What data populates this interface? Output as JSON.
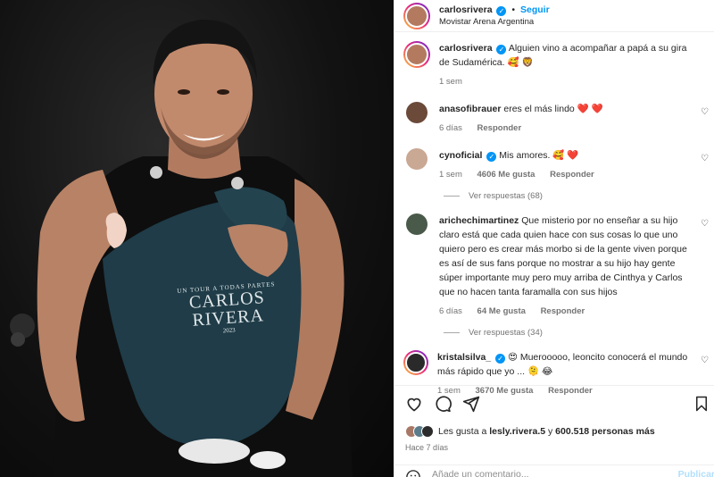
{
  "photo": {
    "sweatshirt_text_small": "UN TOUR A TODAS PARTES",
    "sweatshirt_text_big": "CARLOS RIVERA",
    "sweatshirt_year": "2023"
  },
  "header": {
    "username": "carlosrivera",
    "follow_label": "Seguir",
    "location": "Movistar Arena Argentina"
  },
  "caption": {
    "username": "carlosrivera",
    "text": "Alguien vino a acompañar a papá a su gira de Sudamérica. 🥰 🦁",
    "time": "1 sem"
  },
  "comments": [
    {
      "username": "anasofibrauer",
      "verified": false,
      "text": "eres el más lindo ❤️ ❤️",
      "time": "6 días",
      "likes": "",
      "reply": "Responder",
      "avatar_color": "#6b4a3a"
    },
    {
      "username": "cynoficial",
      "verified": true,
      "text": "Mis amores. 🥰 ❤️",
      "time": "1 sem",
      "likes": "4606 Me gusta",
      "reply": "Responder",
      "view_replies": "Ver respuestas (68)",
      "avatar_color": "#c9a894"
    },
    {
      "username": "arichechimartinez",
      "verified": false,
      "text": "Que misterio por no enseñar a su hijo claro está que cada quien hace con sus cosas lo que uno quiero pero es crear más morbo si de la gente viven porque es así de sus fans porque no mostrar a su hijo hay gente súper importante muy pero muy arriba de Cinthya y Carlos que no hacen tanta faramalla con sus hijos",
      "time": "6 días",
      "likes": "64 Me gusta",
      "reply": "Responder",
      "view_replies": "Ver respuestas (34)",
      "avatar_color": "#4a5a4a"
    },
    {
      "username": "kristalsilva_",
      "verified": true,
      "text": "😍 Muerooooo, leoncito conocerá el mundo más rápido que yo ... 🫠 😂",
      "time": "1 sem",
      "likes": "3670 Me gusta",
      "reply": "Responder",
      "avatar_color": "#2a2a2a"
    }
  ],
  "footer": {
    "likes_prefix": "Les gusta a",
    "likes_user": "lesly.rivera.5",
    "likes_joiner": "y",
    "likes_count": "600.518 personas más",
    "date": "Hace 7 días",
    "add_comment_placeholder": "Añade un comentario...",
    "publish_label": "Publicar"
  },
  "icons": [
    "heart-icon",
    "comment-icon",
    "share-icon",
    "bookmark-icon",
    "emoji-icon"
  ]
}
